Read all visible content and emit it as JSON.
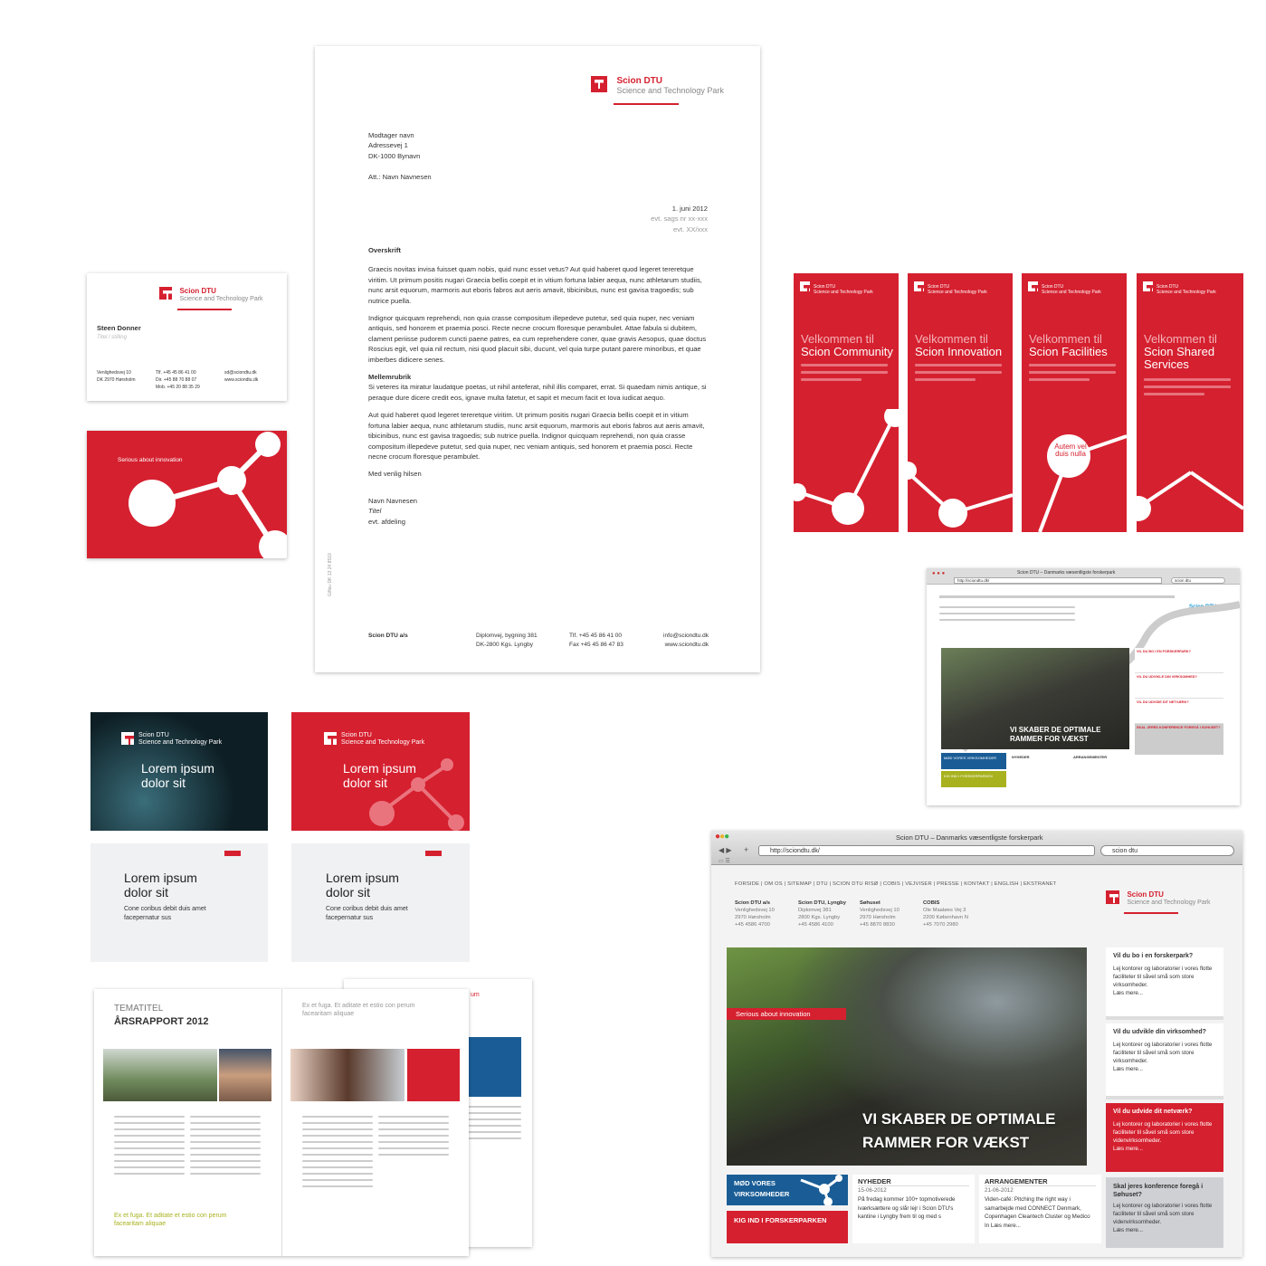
{
  "brand": {
    "name": "Scion DTU",
    "tagline": "Science and Technology Park",
    "serious": "Serious about innovation",
    "red": "#d5202f"
  },
  "letter": {
    "recipient": [
      "Modtager navn",
      "Adressevej 1",
      "DK-1000 Bynavn"
    ],
    "att": "Att.: Navn Navnesen",
    "date": "1. juni 2012",
    "ref1": "evt. sags nr xx-xxx",
    "ref2": "evt. XX/xxx",
    "heading": "Overskrift",
    "p1": "Graecis novitas invisa fuisset quam nobis, quid nunc esset vetus? Aut quid haberet quod legeret tereretque viritim. Ut primum positis nugari Graecia bellis coepit et in vitium fortuna labier aequa, nunc athletarum studiis, nunc arsit equorum, marmoris aut eboris fabros aut aeris amavit, tibicinibus, nunc est gavisa tragoedis; sub nutrice puella.",
    "p2": "Indignor quicquam reprehendi, non quia crasse compositum illepedeve putetur, sed quia nuper, nec veniam antiquis, sed honorem et praemia posci. Recte necne crocum floresque perambulet. Attae fabula si dubitem, clament periisse pudorem cuncti paene patres, ea cum reprehendere coner, quae gravis Aesopus, quae doctus Roscius egit, vel quia nil rectum, nisi quod placuit sibi, ducunt, vel quia turpe putant parere minoribus, et quae imberbes didicere senes.",
    "subheading": "Mellemrubrik",
    "p3": "Si veteres ita miratur laudatque poetas, ut nihil anteferat, nihil illis comparet, errat. Si quaedam nimis antique, si peraque dure dicere credit eos, ignave multa fatetur, et sapit et mecum facit et Iova iudicat aequo.",
    "p4": "Aut quid haberet quod legeret tereretque viritim. Ut primum positis nugari Graecia bellis coepit et in vitium fortuna labier aequa, nunc athletarum studiis, nunc arsit equorum, marmoris aut eboris fabros aut aeris amavit, tibicinibus, nunc est gavisa tragoedis; sub nutrice puella. Indignor quicquam reprehendi, non quia crasse compositum illepedeve putetur, sed quia nuper, nec veniam antiquis, sed honorem et praemia posci. Recte necne crocum floresque perambulet.",
    "closing": "Med venlig hilsen",
    "sign": [
      "Navn Navnesen",
      "Titel",
      "evt. afdeling"
    ],
    "vertical": "Giftsu DK 13 24 8519",
    "footer": {
      "company": "Scion DTU a/s",
      "addr1": "Diplomvej, bygning 381",
      "addr2": "DK-2800 Kgs. Lyngby",
      "tel": "Tlf.  +45 45 86 41 00",
      "fax": "Fax  +45 45 86 47 83",
      "mail": "info@sciondtu.dk",
      "web": "www.sciondtu.dk"
    }
  },
  "card": {
    "name": "Steen Donner",
    "title": "Titel / stilling",
    "addr1": "Venlighedsvej 10",
    "addr2": "DK 2970 Hørsholm",
    "tel": "Tlf.  +45 45 86 41 00",
    "dir": "Dir.  +45 88 70 88 07",
    "mob": "Mob. +45 20 88 35 29",
    "mail": "sd@sciondtu.dk",
    "web": "www.sciondtu.dk"
  },
  "banners": [
    {
      "l1": "Velkommen til",
      "l2": "Scion Community",
      "l3": ""
    },
    {
      "l1": "Velkommen til",
      "l2": "Scion Innovation",
      "l3": ""
    },
    {
      "l1": "Velkommen til",
      "l2": "Scion Facilities",
      "l3": "",
      "circle": "Autem vel duis nulla"
    },
    {
      "l1": "Velkommen til",
      "l2": "Scion Shared",
      "l3": "Services"
    }
  ],
  "slides": {
    "dark": {
      "l1": "Lorem ipsum",
      "l2": "dolor sit"
    },
    "red": {
      "l1": "Lorem ipsum",
      "l2": "dolor sit"
    }
  },
  "white_slides": [
    {
      "l1": "Lorem ipsum",
      "l2": "dolor sit",
      "sub1": "Cone coribus debit duis amet",
      "sub2": "facepernatur sus"
    },
    {
      "l1": "Lorem ipsum",
      "l2": "dolor sit",
      "sub1": "Cone coribus debit duis amet",
      "sub2": "facepernatur sus"
    }
  ],
  "report": {
    "tematitel": "TEMATITEL",
    "title": "ÅRSRAPPORT 2012",
    "quote_top": "Ex et fuga. Et aditate et estio con perum facearitam aliquae",
    "quote_bottom": "Ex et fuga. Et aditate et estio con perum facearitam aliquae",
    "back_fragment": "um"
  },
  "web_small": {
    "title": "Scion DTU – Danmarks væsentligste forskerpark",
    "url": "http://sciondtu.dk/",
    "search": "scion dtu",
    "hero": "VI SKABER DE OPTIMALE RAMMER FOR VÆKST",
    "t1": "MØD VORES VIRKSOMHEDER",
    "t2": "KIG IND I FORSKERPARKEN",
    "t3": "NYHEDER",
    "t4": "ARRANGEMENTER",
    "s1": "VIL DU BO I EN FORSKERPARK?",
    "s2": "VIL DU UDVIKLE DIN VIRKSOMHED?",
    "s3": "VIL DU UDVIDE DIT NETVÆRK?",
    "s4": "SKAL JERES KONFERENCE FOREGÅ I SOHUSET?"
  },
  "web_big": {
    "title": "Scion DTU – Danmarks væsentligste forskerpark",
    "url": "http://sciondtu.dk/",
    "search": "scion dtu",
    "menu": "FORSIDE  |  OM OS  |  SITEMAP  |  DTU  |  SCION DTU RISØ  |  COBIS  |  VEJVISER  |  PRESSE  |  KONTAKT  |  ENGLISH  |  EKSTRANET",
    "addresses": [
      {
        "h": "Scion DTU a/s",
        "a": "Venlighedsvej 10",
        "b": "2970 Hørsholm",
        "c": "+45 4586 4700"
      },
      {
        "h": "Scion DTU, Lyngby",
        "a": "Diplomvej 381",
        "b": "2800 Kgs. Lyngby",
        "c": "+45 4586 4100"
      },
      {
        "h": "Søhuset",
        "a": "Venlighedsvej 10",
        "b": "2970 Hørsholm",
        "c": "+45 8870 8830"
      },
      {
        "h": "COBIS",
        "a": "Ole Maaløes Vej 3",
        "b": "2200 København N",
        "c": "+45 7070 2980"
      }
    ],
    "serious": "Serious about innovation",
    "hero1": "VI SKABER DE OPTIMALE",
    "hero2": "RAMMER FOR VÆKST",
    "side": [
      {
        "h": "Vil du bo i en forskerpark?",
        "t": "Lej kontorer og laboratorier i vores flotte faciliteter til såvel små som store virksomheder.",
        "more": "Læs mere..."
      },
      {
        "h": "Vil du udvikle din virksomhed?",
        "t": "Lej kontorer og laboratorier i vores flotte faciliteter til såvel små som store virksomheder.",
        "more": "Læs mere..."
      },
      {
        "h": "Vil du udvide dit netværk?",
        "t": "Lej kontorer og laboratorier i vores flotte faciliteter til såvel små som store videnvirksomheder.",
        "more": "Læs mere..."
      },
      {
        "h": "Skal jeres konference foregå i Søhuset?",
        "t": "Lej kontorer og laboratorier i vores flotte faciliteter til såvel små som store videnvirksomheder.",
        "more": "Læs mere..."
      }
    ],
    "tile1": "MØD VORES VIRKSOMHEDER",
    "tile2": "KIG IND I FORSKERPARKEN",
    "news": {
      "h": "NYHEDER",
      "date": "15-06-2012",
      "t": "På fredag kommer 100+ topmotiverede iværksættere og slår lejr i Scion DTU's kantine i Lyngby frem til og med s"
    },
    "events": {
      "h": "ARRANGEMENTER",
      "date": "21-06-2012",
      "t": "Viden-café: Pitching the right way i samarbejde med CONNECT Denmark, Copenhagen Cleantech Cluster og Medico In Læs mere..."
    }
  }
}
